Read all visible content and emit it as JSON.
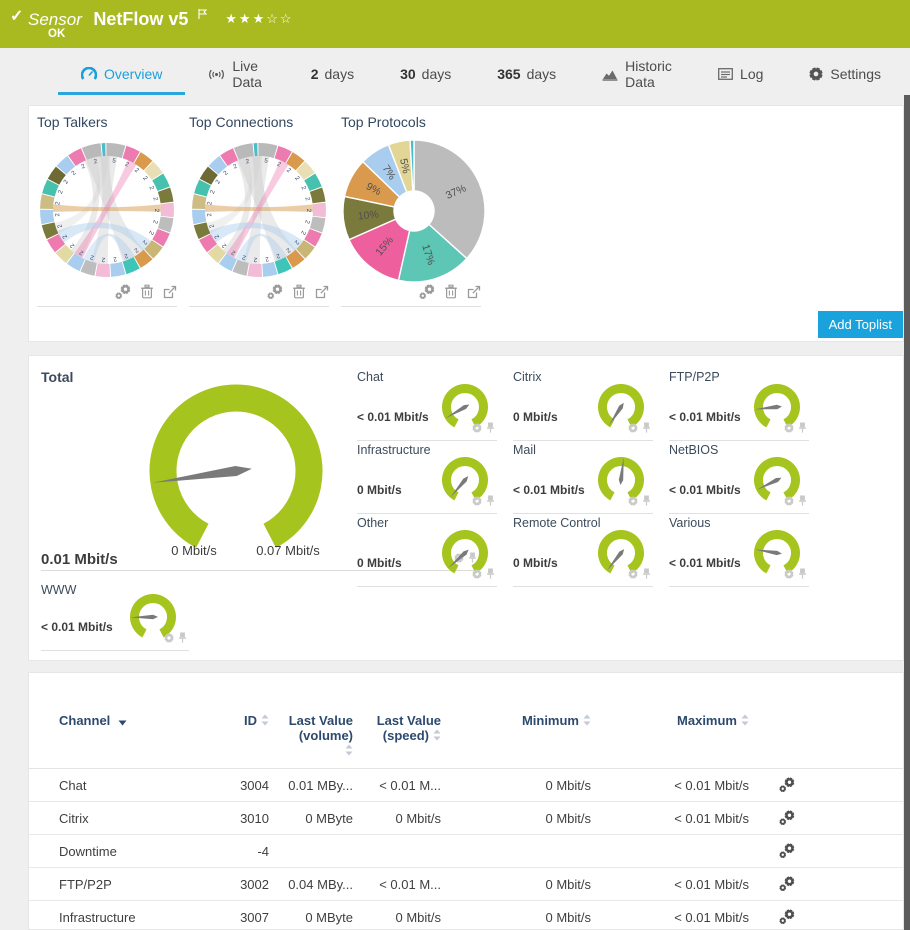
{
  "colors": {
    "header_green": "#a9ba21",
    "gauge_green": "#a6c41e",
    "needle_gray": "#7a7a7a",
    "accent_blue": "#1aa2dc",
    "title_navy": "#33475f",
    "table_header_navy": "#2d4a6e",
    "icon_light_gray": "#c9c9c9",
    "dark_strip": "#5c5c5c"
  },
  "header": {
    "kind": "Sensor",
    "title": "NetFlow v5",
    "status": "OK",
    "stars": "★★★☆☆"
  },
  "tabs": [
    {
      "id": "overview",
      "icon": "gauge-icon",
      "label": "Overview",
      "active": true
    },
    {
      "id": "live-data",
      "icon": "live-icon",
      "label": "Live Data",
      "active": false
    },
    {
      "id": "2-days",
      "strong": "2",
      "label": "days",
      "active": false
    },
    {
      "id": "30-days",
      "strong": "30",
      "label": "days",
      "active": false
    },
    {
      "id": "365-days",
      "strong": "365",
      "label": "days",
      "active": false
    },
    {
      "id": "historic-data",
      "icon": "historic-icon",
      "label": "Historic Data",
      "active": false
    },
    {
      "id": "log",
      "icon": "log-icon",
      "label": "Log",
      "active": false
    },
    {
      "id": "settings",
      "icon": "gear-icon",
      "label": "Settings",
      "active": false
    }
  ],
  "toplists": {
    "add_button": "Add Toplist",
    "items": [
      {
        "title": "Top Talkers",
        "type": "chord"
      },
      {
        "title": "Top Connections",
        "type": "chord"
      },
      {
        "title": "Top Protocols",
        "type": "donut"
      }
    ]
  },
  "chart_data": [
    {
      "type": "chord",
      "title": "Top Talkers",
      "segments": [
        {
          "w": 1.3,
          "c": "#b9b9b9"
        },
        {
          "w": 0.3,
          "c": "#49bec9"
        },
        {
          "w": 1.3,
          "c": "#b9b9b9"
        },
        {
          "w": 1,
          "c": "#ee7bb0"
        },
        {
          "w": 1,
          "c": "#d99a4e"
        },
        {
          "w": 1,
          "c": "#e9dfb4"
        },
        {
          "w": 1,
          "c": "#45c1ae"
        },
        {
          "w": 1,
          "c": "#7b7a3d"
        },
        {
          "w": 1,
          "c": "#f2bcd6"
        },
        {
          "w": 1,
          "c": "#bdbdbd"
        },
        {
          "w": 1,
          "c": "#ee7bb0"
        },
        {
          "w": 1,
          "c": "#c9b575"
        },
        {
          "w": 1,
          "c": "#d99a4e"
        },
        {
          "w": 1,
          "c": "#3fc4b8"
        },
        {
          "w": 1,
          "c": "#a9cdee"
        },
        {
          "w": 1,
          "c": "#f2bcd6"
        },
        {
          "w": 1,
          "c": "#bdbdbd"
        },
        {
          "w": 1,
          "c": "#a9cdee"
        },
        {
          "w": 1,
          "c": "#e3d9a2"
        },
        {
          "w": 1,
          "c": "#ee7bb0"
        },
        {
          "w": 1,
          "c": "#7b7a3d"
        },
        {
          "w": 1,
          "c": "#a9cdee"
        },
        {
          "w": 1,
          "c": "#cdbd85"
        },
        {
          "w": 1,
          "c": "#45c1ae"
        },
        {
          "w": 1,
          "c": "#6d6a35"
        },
        {
          "w": 1,
          "c": "#a9cdee"
        },
        {
          "w": 1,
          "c": "#ee7bb0"
        }
      ],
      "tick_labels": [
        "2",
        "",
        "5",
        "2",
        "2",
        "2",
        "2",
        "2",
        "2",
        "2",
        "2",
        "2",
        "2",
        "2",
        "2",
        "2",
        "2",
        "2",
        "2",
        "2",
        "2",
        "2",
        "2",
        "2",
        "2",
        "2",
        "2"
      ],
      "ribbons": [
        {
          "a": 100,
          "b": -60,
          "w": 13,
          "c": "#b9b9b9",
          "o": 0.3
        },
        {
          "a": 88,
          "b": 262,
          "w": 9,
          "c": "#c2c2c2",
          "o": 0.35
        },
        {
          "a": 108,
          "b": 235,
          "w": 7,
          "c": "#c2c2c2",
          "o": 0.35
        },
        {
          "a": 95,
          "b": 200,
          "w": 6,
          "c": "#cccccc",
          "o": 0.3
        },
        {
          "a": 178,
          "b": 2,
          "w": 4,
          "c": "#d8a45c",
          "o": 0.55
        },
        {
          "a": 62,
          "b": 238,
          "w": 5,
          "c": "#ee7bb0",
          "o": 0.4
        },
        {
          "a": 210,
          "b": 318,
          "w": 7,
          "c": "#a9cdee",
          "o": 0.45
        },
        {
          "a": 250,
          "b": 295,
          "w": 6,
          "c": "#a9cdee",
          "o": 0.4
        }
      ]
    },
    {
      "type": "chord",
      "title": "Top Connections",
      "segments": [
        {
          "w": 1.3,
          "c": "#b9b9b9"
        },
        {
          "w": 0.3,
          "c": "#49bec9"
        },
        {
          "w": 1.3,
          "c": "#b9b9b9"
        },
        {
          "w": 1,
          "c": "#ee7bb0"
        },
        {
          "w": 1,
          "c": "#d99a4e"
        },
        {
          "w": 1,
          "c": "#e9dfb4"
        },
        {
          "w": 1,
          "c": "#45c1ae"
        },
        {
          "w": 1,
          "c": "#7b7a3d"
        },
        {
          "w": 1,
          "c": "#f2bcd6"
        },
        {
          "w": 1,
          "c": "#bdbdbd"
        },
        {
          "w": 1,
          "c": "#ee7bb0"
        },
        {
          "w": 1,
          "c": "#c9b575"
        },
        {
          "w": 1,
          "c": "#d99a4e"
        },
        {
          "w": 1,
          "c": "#3fc4b8"
        },
        {
          "w": 1,
          "c": "#a9cdee"
        },
        {
          "w": 1,
          "c": "#f2bcd6"
        },
        {
          "w": 1,
          "c": "#bdbdbd"
        },
        {
          "w": 1,
          "c": "#a9cdee"
        },
        {
          "w": 1,
          "c": "#e3d9a2"
        },
        {
          "w": 1,
          "c": "#ee7bb0"
        },
        {
          "w": 1,
          "c": "#7b7a3d"
        },
        {
          "w": 1,
          "c": "#a9cdee"
        },
        {
          "w": 1,
          "c": "#cdbd85"
        },
        {
          "w": 1,
          "c": "#45c1ae"
        },
        {
          "w": 1,
          "c": "#6d6a35"
        },
        {
          "w": 1,
          "c": "#a9cdee"
        },
        {
          "w": 1,
          "c": "#ee7bb0"
        }
      ],
      "tick_labels": [
        "2",
        "",
        "5",
        "2",
        "2",
        "2",
        "2",
        "2",
        "2",
        "2",
        "2",
        "2",
        "2",
        "2",
        "2",
        "2",
        "2",
        "2",
        "2",
        "2",
        "2",
        "2",
        "2",
        "2",
        "2",
        "2",
        "2"
      ],
      "ribbons": [
        {
          "a": 100,
          "b": -60,
          "w": 13,
          "c": "#b9b9b9",
          "o": 0.3
        },
        {
          "a": 88,
          "b": 262,
          "w": 9,
          "c": "#c2c2c2",
          "o": 0.35
        },
        {
          "a": 108,
          "b": 235,
          "w": 7,
          "c": "#c2c2c2",
          "o": 0.35
        },
        {
          "a": 95,
          "b": 200,
          "w": 6,
          "c": "#cccccc",
          "o": 0.3
        },
        {
          "a": 178,
          "b": 2,
          "w": 4,
          "c": "#d8a45c",
          "o": 0.55
        },
        {
          "a": 62,
          "b": 238,
          "w": 5,
          "c": "#ee7bb0",
          "o": 0.4
        },
        {
          "a": 210,
          "b": 318,
          "w": 7,
          "c": "#a9cdee",
          "o": 0.45
        },
        {
          "a": 250,
          "b": 295,
          "w": 6,
          "c": "#a9cdee",
          "o": 0.4
        }
      ]
    },
    {
      "type": "pie",
      "title": "Top Protocols",
      "values": [
        37,
        17,
        15,
        10,
        9,
        7,
        5,
        0.9
      ],
      "labels": [
        "37%",
        "17%",
        "15%",
        "10%",
        "9%",
        "7%",
        "5%",
        ""
      ],
      "colors": [
        "#bcbcbc",
        "#5ec6b4",
        "#ee5f9e",
        "#7b7a3d",
        "#d99a4e",
        "#a9cdee",
        "#e3d595",
        "#49bec9"
      ]
    }
  ],
  "gauges": {
    "total": {
      "title": "Total",
      "value": "0.01 Mbit/s",
      "min_label": "0 Mbit/s",
      "max_label": "0.07 Mbit/s",
      "needle_angle": 188
    },
    "small": [
      {
        "title": "Chat",
        "value": "< 0.01 Mbit/s",
        "needle_angle": 210
      },
      {
        "title": "Citrix",
        "value": "0 Mbit/s",
        "needle_angle": 237
      },
      {
        "title": "FTP/P2P",
        "value": "< 0.01 Mbit/s",
        "needle_angle": 186
      },
      {
        "title": "Infrastructure",
        "value": "0 Mbit/s",
        "needle_angle": 230
      },
      {
        "title": "Mail",
        "value": "< 0.01 Mbit/s",
        "needle_angle": 83
      },
      {
        "title": "NetBIOS",
        "value": "< 0.01 Mbit/s",
        "needle_angle": 206
      },
      {
        "title": "Other",
        "value": "0 Mbit/s",
        "needle_angle": 222
      },
      {
        "title": "Remote Control",
        "value": "0 Mbit/s",
        "needle_angle": 231
      },
      {
        "title": "Various",
        "value": "< 0.01 Mbit/s",
        "needle_angle": 171
      }
    ],
    "www": {
      "title": "WWW",
      "value": "< 0.01 Mbit/s",
      "needle_angle": 181
    }
  },
  "table": {
    "columns": [
      {
        "label": "Channel",
        "sort": "desc"
      },
      {
        "label": "ID",
        "sort": "both"
      },
      {
        "label": "Last Value",
        "label2": "(volume)",
        "sort": "both"
      },
      {
        "label": "Last Value",
        "label2": "(speed)",
        "sort": "both"
      },
      {
        "label": "Minimum",
        "sort": "both"
      },
      {
        "label": "Maximum",
        "sort": "both"
      }
    ],
    "rows": [
      {
        "channel": "Chat",
        "id": "3004",
        "last_volume": "0.01 MBy...",
        "last_speed": "< 0.01 M...",
        "min": "0 Mbit/s",
        "max": "< 0.01 Mbit/s"
      },
      {
        "channel": "Citrix",
        "id": "3010",
        "last_volume": "0 MByte",
        "last_speed": "0 Mbit/s",
        "min": "0 Mbit/s",
        "max": "< 0.01 Mbit/s"
      },
      {
        "channel": "Downtime",
        "id": "-4",
        "last_volume": "",
        "last_speed": "",
        "min": "",
        "max": ""
      },
      {
        "channel": "FTP/P2P",
        "id": "3002",
        "last_volume": "0.04 MBy...",
        "last_speed": "< 0.01 M...",
        "min": "0 Mbit/s",
        "max": "< 0.01 Mbit/s"
      },
      {
        "channel": "Infrastructure",
        "id": "3007",
        "last_volume": "0 MByte",
        "last_speed": "0 Mbit/s",
        "min": "0 Mbit/s",
        "max": "< 0.01 Mbit/s"
      }
    ]
  }
}
